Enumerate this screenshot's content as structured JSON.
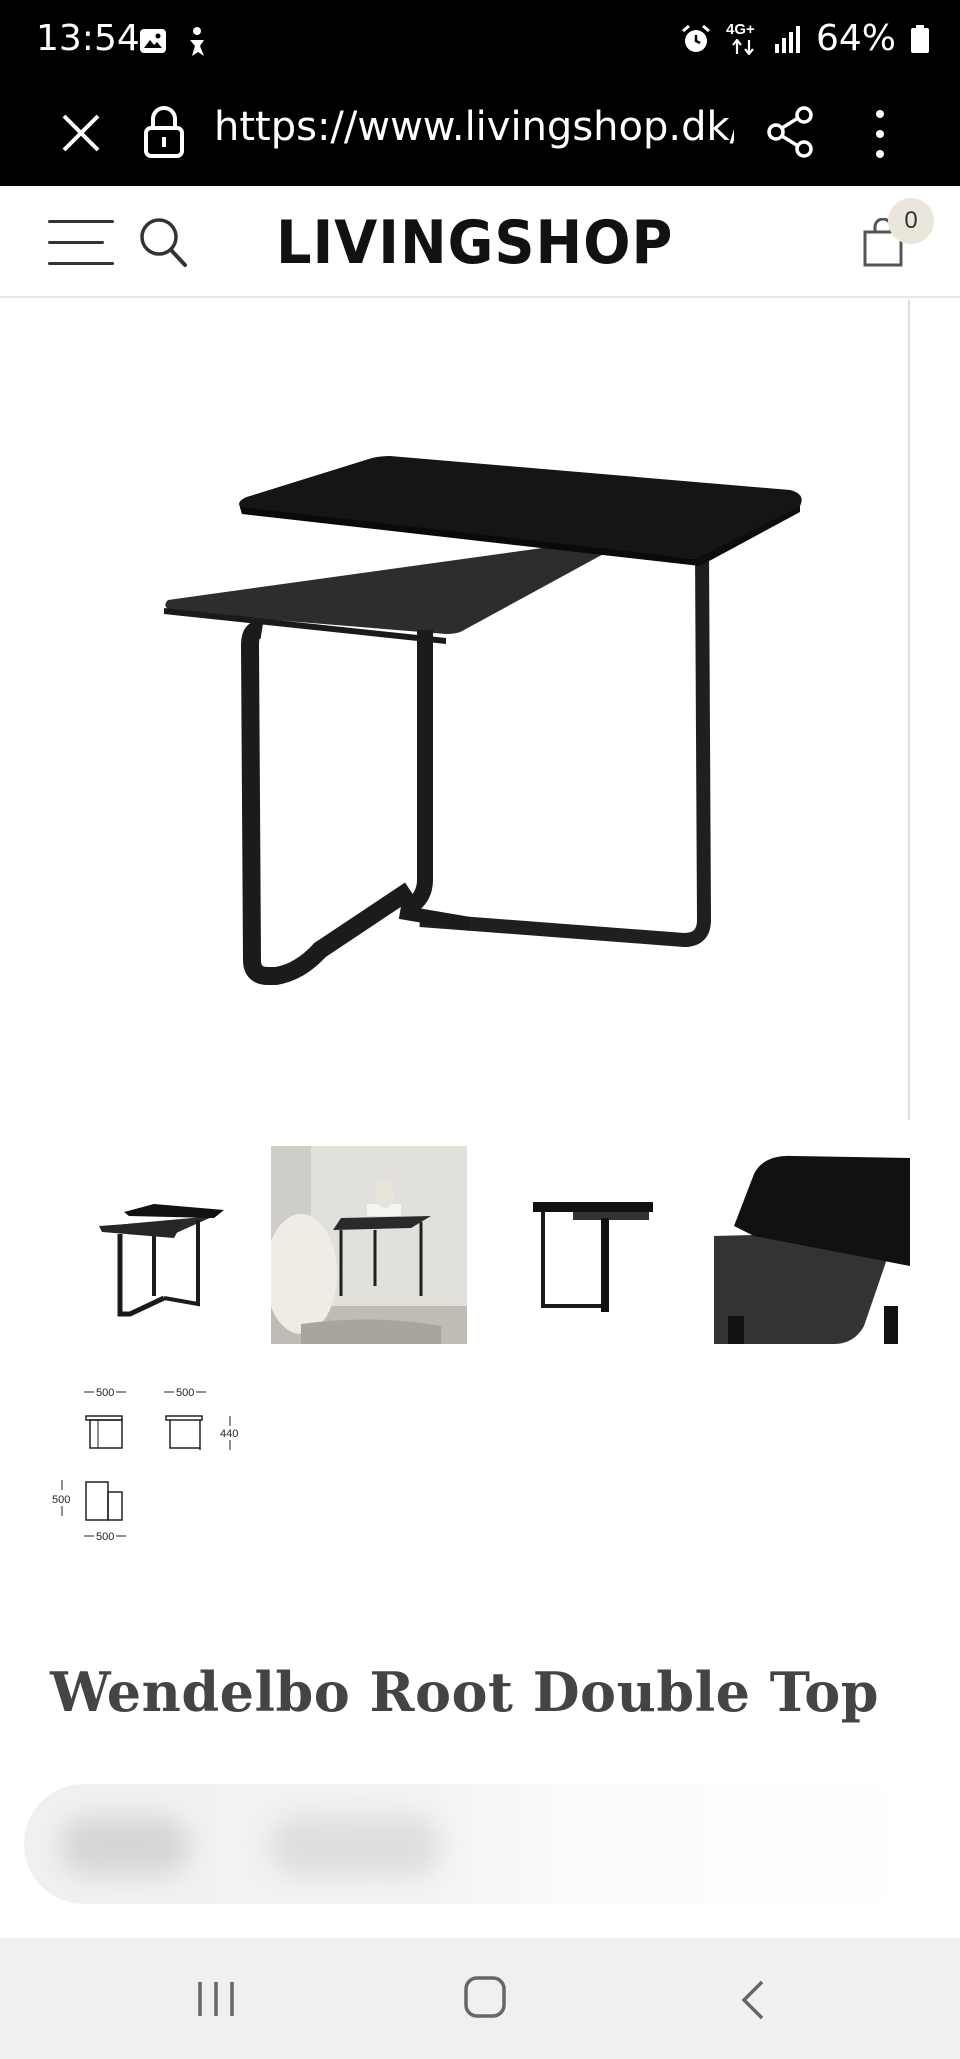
{
  "status_bar": {
    "time": "13:54",
    "left_icons": [
      "gallery-icon",
      "accessibility-icon"
    ],
    "right_icons": [
      "alarm-icon",
      "4g-data-icon",
      "signal-icon",
      "battery-icon"
    ],
    "network_label": "4G+",
    "battery_percent": "64%"
  },
  "browser": {
    "url": "https://www.livingshop.dk/w",
    "close_icon": "close-icon",
    "lock_icon": "lock-icon",
    "share_icon": "share-icon",
    "menu_icon": "more-vert-icon"
  },
  "site_header": {
    "logo": "LIVINGSHOP",
    "menu_icon": "hamburger-icon",
    "search_icon": "search-icon",
    "cart_icon": "shopping-bag-icon",
    "cart_count": "0"
  },
  "gallery": {
    "thumbnails": [
      "product-front",
      "lifestyle-interior",
      "product-side",
      "product-detail"
    ],
    "dimensions": {
      "width_top": "500",
      "width_top_2": "500",
      "height": "440",
      "depth": "500",
      "width_bottom": "500"
    }
  },
  "product": {
    "title": "Wendelbo Root Double Top"
  },
  "android_nav": {
    "recents_icon": "recents-icon",
    "home_icon": "home-icon",
    "back_icon": "back-icon"
  }
}
